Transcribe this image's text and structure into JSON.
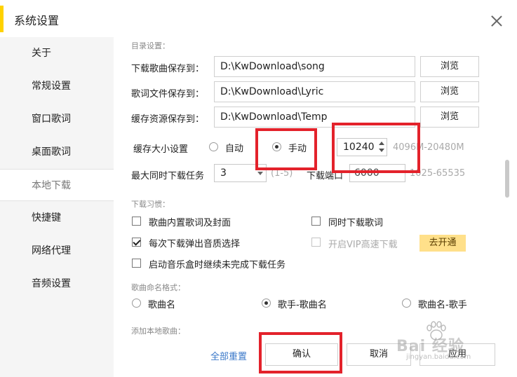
{
  "window": {
    "title": "系统设置",
    "close_icon": "close-icon"
  },
  "sidebar": {
    "items": [
      {
        "label": "关于"
      },
      {
        "label": "常规设置"
      },
      {
        "label": "窗口歌词"
      },
      {
        "label": "桌面歌词"
      },
      {
        "label": "本地下载",
        "active": true
      },
      {
        "label": "快捷键"
      },
      {
        "label": "网络代理"
      },
      {
        "label": "音频设置"
      }
    ]
  },
  "directory": {
    "section_label": "目录设置：",
    "rows": [
      {
        "label": "下载歌曲保存到：",
        "value": "D:\\KwDownload\\song",
        "button": "浏览"
      },
      {
        "label": "歌词文件保存到：",
        "value": "D:\\KwDownload\\Lyric",
        "button": "浏览"
      },
      {
        "label": "缓存资源保存到：",
        "value": "D:\\KwDownload\\Temp",
        "button": "浏览"
      }
    ]
  },
  "cache": {
    "label": "缓存大小设置",
    "option_auto": "自动",
    "option_manual": "手动",
    "selected": "手动",
    "size_value": "10240",
    "size_range": "4096M-20480M"
  },
  "concurrency": {
    "label": "最大同时下载任务",
    "value": "3",
    "range": "(1-5)",
    "port_label": "下载端口",
    "port_value": "6000",
    "port_range": "1025-65535"
  },
  "habits": {
    "section_label": "下载习惯：",
    "options": [
      {
        "label": "歌曲内置歌词及封面",
        "checked": false
      },
      {
        "label": "同时下载歌词",
        "checked": false
      },
      {
        "label": "每次下载弹出音质选择",
        "checked": true
      },
      {
        "label": "开启VIP高速下载",
        "checked": false,
        "disabled": true
      },
      {
        "label": "启动音乐盒时继续未完成下载任务",
        "checked": false
      }
    ],
    "vip_button": "去开通"
  },
  "naming": {
    "section_label": "歌曲命名格式：",
    "options": [
      "歌曲名",
      "歌手-歌曲名",
      "歌曲名-歌手"
    ],
    "selected": "歌手-歌曲名"
  },
  "add_local": {
    "section_label": "添加本地歌曲："
  },
  "footer": {
    "reset_label": "全部重置",
    "confirm_label": "确认",
    "cancel_label": "取消",
    "apply_label": "应用"
  },
  "watermark": {
    "text": "Bai 经验",
    "sub": "jingyan.baidu.com"
  },
  "colors": {
    "accent": "#ffd200",
    "annotation": "#e3222b",
    "link": "#3a78c9",
    "vip": "#ffe08a"
  }
}
